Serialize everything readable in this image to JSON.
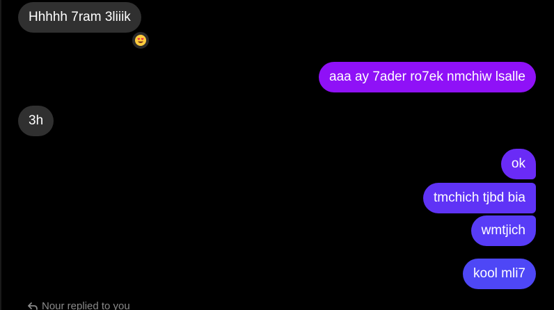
{
  "messages": {
    "incoming": [
      {
        "text": "Hhhhh 7ram 3liiik",
        "reaction": "heart-eyes-emoji-icon"
      },
      {
        "text": "3h"
      }
    ],
    "outgoing": [
      {
        "text": "aaa ay 7ader ro7ek nmchiw lsalle",
        "color": "#8f11f7"
      },
      {
        "text": "ok",
        "color": "#6a2bf6"
      },
      {
        "text": "tmchich tjbd bia",
        "color": "#5f33f6"
      },
      {
        "text": "wmtjich",
        "color": "#583cf7"
      },
      {
        "text": "kool mli7",
        "color": "#4e47f6"
      }
    ]
  },
  "reply_note": {
    "icon": "reply-arrow-icon",
    "text": "Nour replied to you"
  },
  "colors": {
    "background": "#000000",
    "incoming_bubble": "#303030",
    "reaction_bg": "#2b2b2b",
    "reply_text": "#8a8a8a"
  }
}
